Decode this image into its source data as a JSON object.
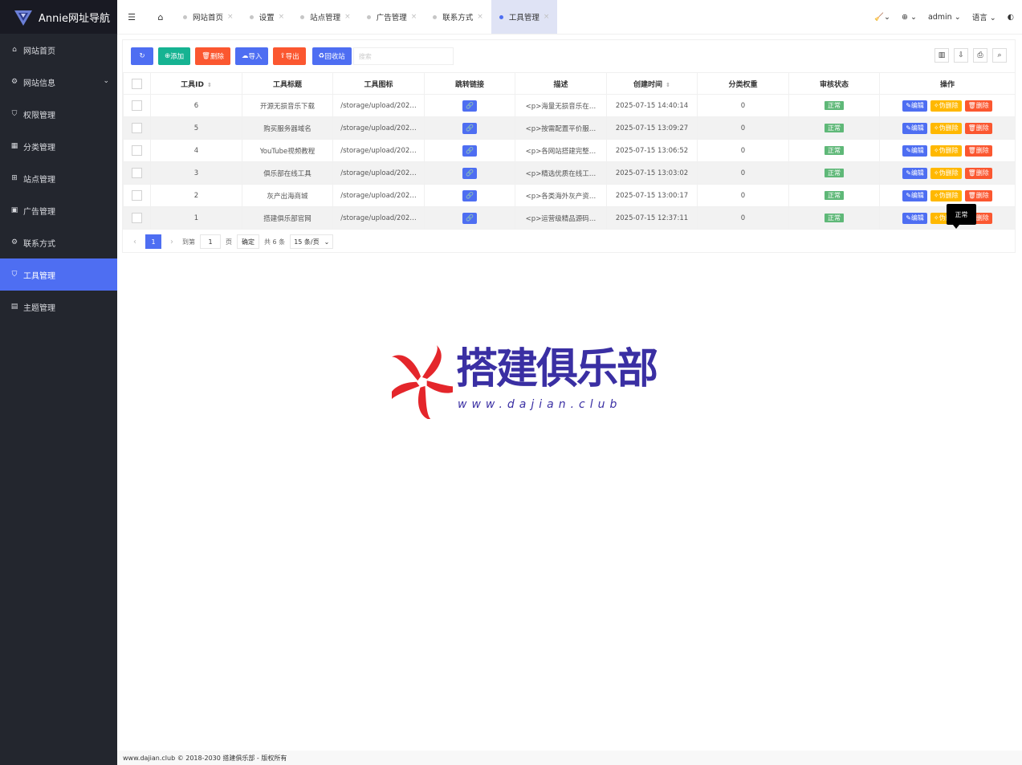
{
  "brand": {
    "name": "Annie网址导航"
  },
  "sidebar": {
    "items": [
      {
        "label": "网站首页",
        "icon": "home-icon"
      },
      {
        "label": "网站信息",
        "icon": "gear-icon"
      },
      {
        "label": "权限管理",
        "icon": "shield-icon"
      },
      {
        "label": "分类管理",
        "icon": "grid-icon"
      },
      {
        "label": "站点管理",
        "icon": "windows-icon"
      },
      {
        "label": "广告管理",
        "icon": "image-icon"
      },
      {
        "label": "联系方式",
        "icon": "gear-icon"
      },
      {
        "label": "工具管理",
        "icon": "shield-check-icon"
      },
      {
        "label": "主题管理",
        "icon": "table-icon"
      }
    ],
    "active_index": 7
  },
  "tabs": [
    {
      "label": "网站首页"
    },
    {
      "label": "设置"
    },
    {
      "label": "站点管理"
    },
    {
      "label": "广告管理"
    },
    {
      "label": "联系方式"
    },
    {
      "label": "工具管理"
    }
  ],
  "topbar": {
    "user": "admin",
    "language": "语言"
  },
  "toolbar": {
    "add": "添加",
    "delete": "删除",
    "import": "导入",
    "export": "导出",
    "recycle": "回收站",
    "search_placeholder": "搜索"
  },
  "table": {
    "columns": [
      "工具ID",
      "工具标题",
      "工具图标",
      "跳转链接",
      "描述",
      "创建时间",
      "分类权重",
      "审核状态",
      "操作"
    ],
    "rows": [
      {
        "id": "6",
        "title": "开源无损音乐下载",
        "icon": "/storage/upload/202…",
        "desc": "<p>海量无损音乐在…",
        "time": "2025-07-15 14:40:14",
        "weight": "0",
        "status": "正常"
      },
      {
        "id": "5",
        "title": "购买服务器域名",
        "icon": "/storage/upload/202…",
        "desc": "<p>按需配置平价服…",
        "time": "2025-07-15 13:09:27",
        "weight": "0",
        "status": "正常"
      },
      {
        "id": "4",
        "title": "YouTube视频教程",
        "icon": "/storage/upload/202…",
        "desc": "<p>各网站搭建完整…",
        "time": "2025-07-15 13:06:52",
        "weight": "0",
        "status": "正常"
      },
      {
        "id": "3",
        "title": "俱乐部在线工具",
        "icon": "/storage/upload/202…",
        "desc": "<p>精选优质在线工…",
        "time": "2025-07-15 13:03:02",
        "weight": "0",
        "status": "正常"
      },
      {
        "id": "2",
        "title": "灰产出海商城",
        "icon": "/storage/upload/202…",
        "desc": "<p>各类海外灰产资…",
        "time": "2025-07-15 13:00:17",
        "weight": "0",
        "status": "正常"
      },
      {
        "id": "1",
        "title": "搭建俱乐部官网",
        "icon": "/storage/upload/202…",
        "desc": "<p>运营级精品源码…",
        "time": "2025-07-15 12:37:11",
        "weight": "0",
        "status": "正常"
      }
    ],
    "actions": {
      "edit": "编辑",
      "soft_delete": "伪删除",
      "delete": "删除"
    },
    "tooltip": "正常"
  },
  "pager": {
    "current": "1",
    "goto_label": "到第",
    "goto_value": "1",
    "page_unit": "页",
    "confirm": "确定",
    "total": "共 6 条",
    "per_page": "15 条/页"
  },
  "watermark": {
    "title": "搭建俱乐部",
    "subtitle": "www.dajian.club"
  },
  "footer": {
    "text": "www.dajian.club © 2018-2030 搭建俱乐部 - 版权所有"
  },
  "colors": {
    "sidebar": "#23262e",
    "accent": "#4e6ef2",
    "green": "#16b392",
    "red": "#fb5730",
    "yellow": "#ffb800",
    "status": "#5fb878"
  }
}
